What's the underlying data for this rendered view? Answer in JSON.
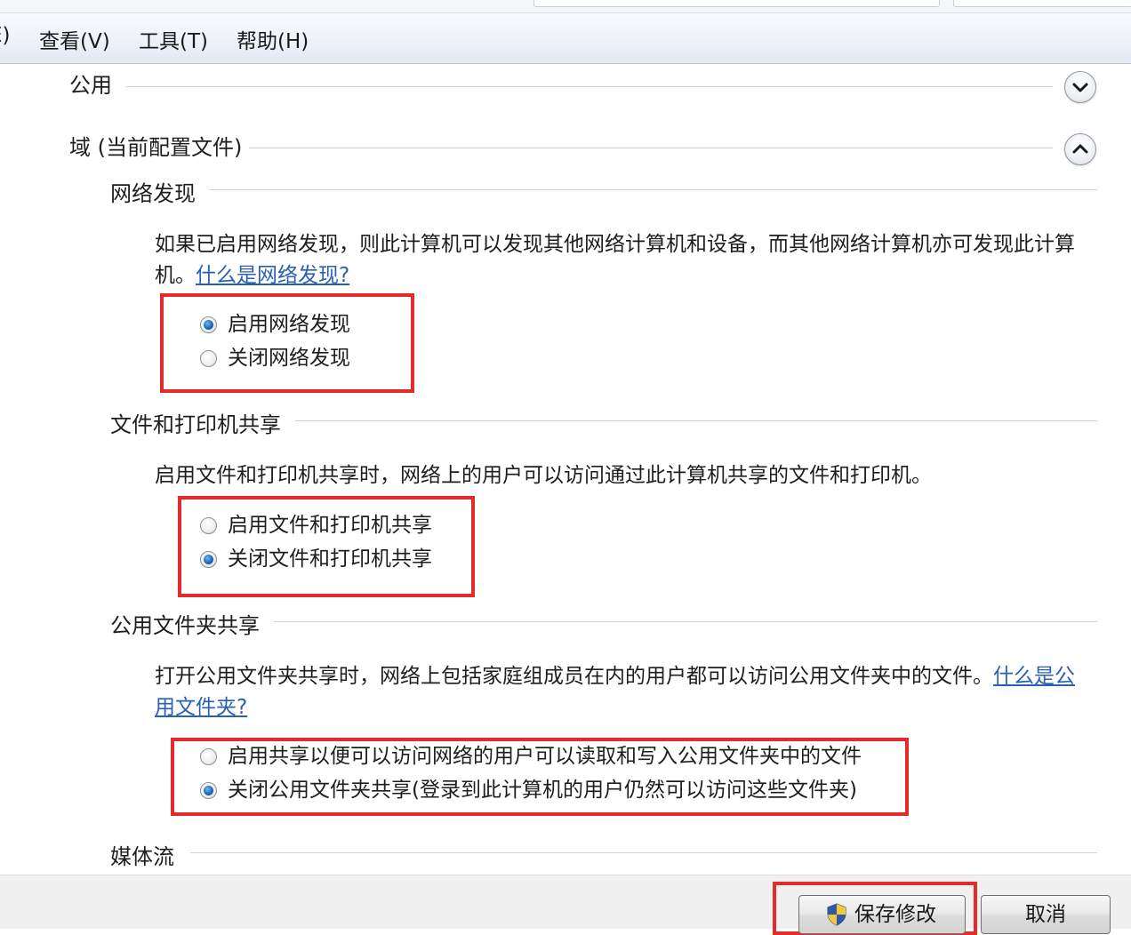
{
  "menu": {
    "partial_item": "E)",
    "view": "查看(V)",
    "tools": "工具(T)",
    "help": "帮助(H)"
  },
  "sections": {
    "public": {
      "title": "公用",
      "expanded": false,
      "chevron_icon": "chevron-down-icon"
    },
    "domain": {
      "title": "域 (当前配置文件)",
      "expanded": true,
      "chevron_icon": "chevron-up-icon"
    }
  },
  "network_discovery": {
    "title": "网络发现",
    "description": "如果已启用网络发现，则此计算机可以发现其他网络计算机和设备，而其他网络计算机亦可发现此计算机。",
    "link": "什么是网络发现?",
    "options": [
      {
        "label": "启用网络发现",
        "selected": true
      },
      {
        "label": "关闭网络发现",
        "selected": false
      }
    ]
  },
  "file_printer_sharing": {
    "title": "文件和打印机共享",
    "description": "启用文件和打印机共享时，网络上的用户可以访问通过此计算机共享的文件和打印机。",
    "options": [
      {
        "label": "启用文件和打印机共享",
        "selected": false
      },
      {
        "label": "关闭文件和打印机共享",
        "selected": true
      }
    ]
  },
  "public_folder_sharing": {
    "title": "公用文件夹共享",
    "description": "打开公用文件夹共享时，网络上包括家庭组成员在内的用户都可以访问公用文件夹中的文件。",
    "link": "什么是公用文件夹?",
    "options": [
      {
        "label": "启用共享以便可以访问网络的用户可以读取和写入公用文件夹中的文件",
        "selected": false
      },
      {
        "label": "关闭公用文件夹共享(登录到此计算机的用户仍然可以访问这些文件夹)",
        "selected": true
      }
    ]
  },
  "media_streaming": {
    "title": "媒体流"
  },
  "buttons": {
    "save": "保存修改",
    "save_icon": "uac-shield-icon",
    "cancel": "取消"
  },
  "colors": {
    "highlight": "#e52a2a",
    "link": "#2a5fb4",
    "radio_selected": "#1e6ab8"
  }
}
